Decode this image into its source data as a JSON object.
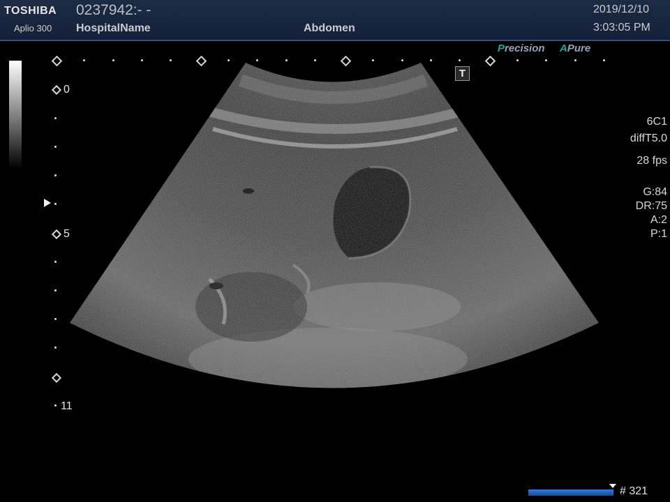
{
  "header": {
    "brand": "TOSHIBA",
    "model": "Aplio 300",
    "patient_id": "0237942:- -",
    "hospital": "HospitalName",
    "exam": "Abdomen",
    "date": "2019/12/10",
    "time": "3:03:05 PM"
  },
  "badges": {
    "precision_initial": "P",
    "precision_rest": "recision",
    "apure_initial": "A",
    "apure_rest": "Pure"
  },
  "depth_scale": {
    "top": "0",
    "mid": "5",
    "bottom": "11"
  },
  "params": {
    "probe": "6C1",
    "mode": "diffT5.0",
    "fps": "28 fps",
    "gain": "G:84",
    "dynamic_range": "DR:75",
    "a": "A:2",
    "p": "P:1"
  },
  "overlay": {
    "t_icon": "T"
  },
  "cine": {
    "frame": "# 321",
    "position": 0.95
  },
  "colors": {
    "accent_teal": "#1fa39a",
    "header_bg": "#1d2b44",
    "cine_blue": "#2f7ae0"
  }
}
